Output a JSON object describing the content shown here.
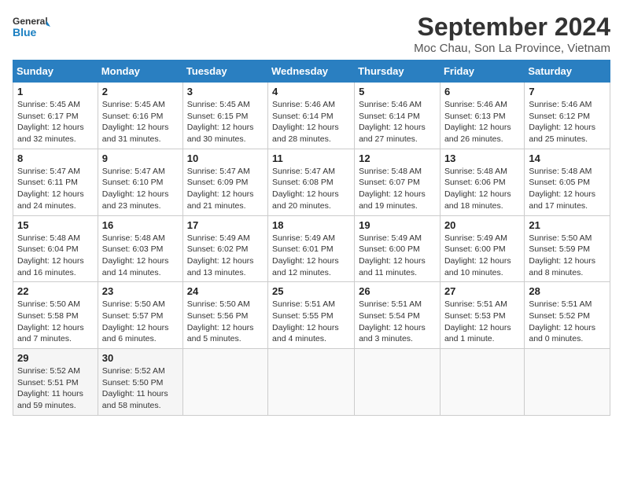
{
  "header": {
    "logo_line1": "General",
    "logo_line2": "Blue",
    "month": "September 2024",
    "location": "Moc Chau, Son La Province, Vietnam"
  },
  "weekdays": [
    "Sunday",
    "Monday",
    "Tuesday",
    "Wednesday",
    "Thursday",
    "Friday",
    "Saturday"
  ],
  "days": [
    {
      "date": "1",
      "sunrise": "5:45 AM",
      "sunset": "6:17 PM",
      "daylight": "12 hours and 32 minutes."
    },
    {
      "date": "2",
      "sunrise": "5:45 AM",
      "sunset": "6:16 PM",
      "daylight": "12 hours and 31 minutes."
    },
    {
      "date": "3",
      "sunrise": "5:45 AM",
      "sunset": "6:15 PM",
      "daylight": "12 hours and 30 minutes."
    },
    {
      "date": "4",
      "sunrise": "5:46 AM",
      "sunset": "6:14 PM",
      "daylight": "12 hours and 28 minutes."
    },
    {
      "date": "5",
      "sunrise": "5:46 AM",
      "sunset": "6:14 PM",
      "daylight": "12 hours and 27 minutes."
    },
    {
      "date": "6",
      "sunrise": "5:46 AM",
      "sunset": "6:13 PM",
      "daylight": "12 hours and 26 minutes."
    },
    {
      "date": "7",
      "sunrise": "5:46 AM",
      "sunset": "6:12 PM",
      "daylight": "12 hours and 25 minutes."
    },
    {
      "date": "8",
      "sunrise": "5:47 AM",
      "sunset": "6:11 PM",
      "daylight": "12 hours and 24 minutes."
    },
    {
      "date": "9",
      "sunrise": "5:47 AM",
      "sunset": "6:10 PM",
      "daylight": "12 hours and 23 minutes."
    },
    {
      "date": "10",
      "sunrise": "5:47 AM",
      "sunset": "6:09 PM",
      "daylight": "12 hours and 21 minutes."
    },
    {
      "date": "11",
      "sunrise": "5:47 AM",
      "sunset": "6:08 PM",
      "daylight": "12 hours and 20 minutes."
    },
    {
      "date": "12",
      "sunrise": "5:48 AM",
      "sunset": "6:07 PM",
      "daylight": "12 hours and 19 minutes."
    },
    {
      "date": "13",
      "sunrise": "5:48 AM",
      "sunset": "6:06 PM",
      "daylight": "12 hours and 18 minutes."
    },
    {
      "date": "14",
      "sunrise": "5:48 AM",
      "sunset": "6:05 PM",
      "daylight": "12 hours and 17 minutes."
    },
    {
      "date": "15",
      "sunrise": "5:48 AM",
      "sunset": "6:04 PM",
      "daylight": "12 hours and 16 minutes."
    },
    {
      "date": "16",
      "sunrise": "5:48 AM",
      "sunset": "6:03 PM",
      "daylight": "12 hours and 14 minutes."
    },
    {
      "date": "17",
      "sunrise": "5:49 AM",
      "sunset": "6:02 PM",
      "daylight": "12 hours and 13 minutes."
    },
    {
      "date": "18",
      "sunrise": "5:49 AM",
      "sunset": "6:01 PM",
      "daylight": "12 hours and 12 minutes."
    },
    {
      "date": "19",
      "sunrise": "5:49 AM",
      "sunset": "6:00 PM",
      "daylight": "12 hours and 11 minutes."
    },
    {
      "date": "20",
      "sunrise": "5:49 AM",
      "sunset": "6:00 PM",
      "daylight": "12 hours and 10 minutes."
    },
    {
      "date": "21",
      "sunrise": "5:50 AM",
      "sunset": "5:59 PM",
      "daylight": "12 hours and 8 minutes."
    },
    {
      "date": "22",
      "sunrise": "5:50 AM",
      "sunset": "5:58 PM",
      "daylight": "12 hours and 7 minutes."
    },
    {
      "date": "23",
      "sunrise": "5:50 AM",
      "sunset": "5:57 PM",
      "daylight": "12 hours and 6 minutes."
    },
    {
      "date": "24",
      "sunrise": "5:50 AM",
      "sunset": "5:56 PM",
      "daylight": "12 hours and 5 minutes."
    },
    {
      "date": "25",
      "sunrise": "5:51 AM",
      "sunset": "5:55 PM",
      "daylight": "12 hours and 4 minutes."
    },
    {
      "date": "26",
      "sunrise": "5:51 AM",
      "sunset": "5:54 PM",
      "daylight": "12 hours and 3 minutes."
    },
    {
      "date": "27",
      "sunrise": "5:51 AM",
      "sunset": "5:53 PM",
      "daylight": "12 hours and 1 minute."
    },
    {
      "date": "28",
      "sunrise": "5:51 AM",
      "sunset": "5:52 PM",
      "daylight": "12 hours and 0 minutes."
    },
    {
      "date": "29",
      "sunrise": "5:52 AM",
      "sunset": "5:51 PM",
      "daylight": "11 hours and 59 minutes."
    },
    {
      "date": "30",
      "sunrise": "5:52 AM",
      "sunset": "5:50 PM",
      "daylight": "11 hours and 58 minutes."
    }
  ]
}
